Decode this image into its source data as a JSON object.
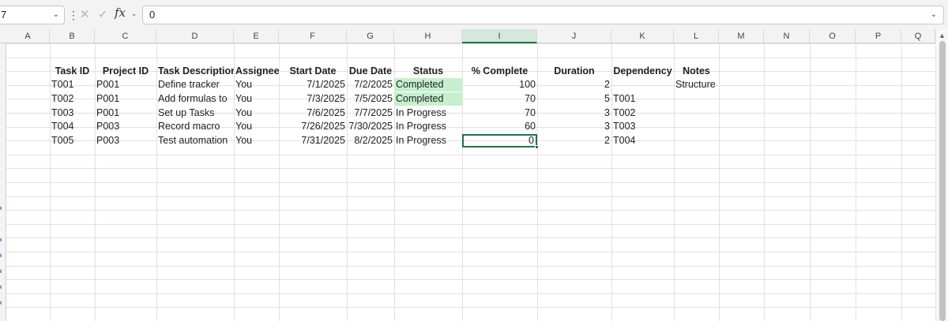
{
  "formula_bar": {
    "name_box": "7",
    "formula_value": "0"
  },
  "columns": [
    "A",
    "B",
    "C",
    "D",
    "E",
    "F",
    "G",
    "H",
    "I",
    "J",
    "K",
    "L",
    "M",
    "N",
    "O",
    "P",
    "Q"
  ],
  "selected_column": "I",
  "table": {
    "headers": [
      "Task ID",
      "Project ID",
      "Task Description",
      "Assignee",
      "Start Date",
      "Due Date",
      "Status",
      "% Complete",
      "Duration",
      "Dependency",
      "Notes"
    ],
    "rows": [
      [
        "T001",
        "P001",
        "Define tracker",
        "You",
        "7/1/2025",
        "7/2/2025",
        "Completed",
        "100",
        "2",
        "",
        "Structure"
      ],
      [
        "T002",
        "P001",
        "Add formulas to",
        "You",
        "7/3/2025",
        "7/5/2025",
        "Completed",
        "70",
        "5",
        "T001",
        ""
      ],
      [
        "T003",
        "P001",
        "Set up Tasks",
        "You",
        "7/6/2025",
        "7/7/2025",
        "In Progress",
        "70",
        "3",
        "T002",
        ""
      ],
      [
        "T004",
        "P003",
        "Record macro",
        "You",
        "7/26/2025",
        "7/30/2025",
        "In Progress",
        "60",
        "3",
        "T003",
        ""
      ],
      [
        "T005",
        "P003",
        "Test automation",
        "You",
        "7/31/2025",
        "8/2/2025",
        "In Progress",
        "0",
        "2",
        "T004",
        ""
      ]
    ]
  },
  "colors": {
    "completed_fill": "#c6efce",
    "selection_accent": "#217346"
  },
  "icons": {
    "cancel": "close-icon",
    "enter": "check-icon",
    "function": "fx-icon"
  }
}
